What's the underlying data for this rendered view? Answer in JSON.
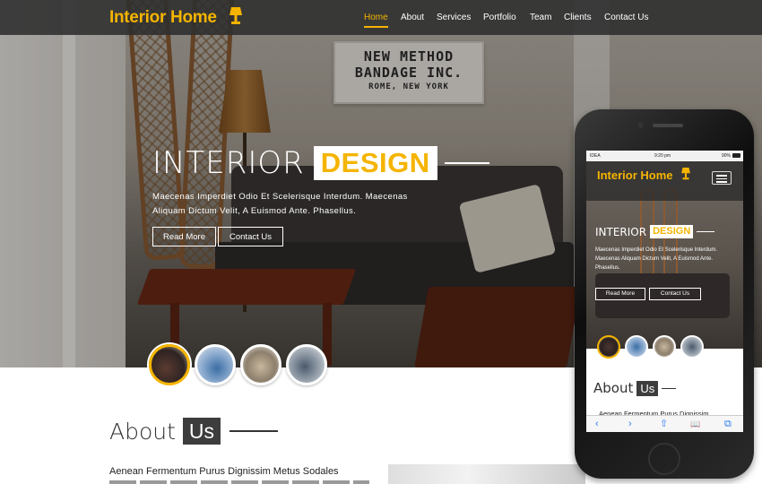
{
  "brand": {
    "name": "Interior Home",
    "accent": "#f5b400"
  },
  "nav": {
    "items": [
      {
        "label": "Home",
        "active": true
      },
      {
        "label": "About"
      },
      {
        "label": "Services"
      },
      {
        "label": "Portfolio"
      },
      {
        "label": "Team"
      },
      {
        "label": "Clients"
      },
      {
        "label": "Contact Us"
      }
    ]
  },
  "hero": {
    "sign": {
      "line1": "NEW METHOD",
      "line2": "BANDAGE INC.",
      "line3": "ROME, NEW YORK"
    },
    "title_plain": "INTERIOR",
    "title_highlight": "DESIGN",
    "description": "Maecenas Imperdiet Odio Et Scelerisque Interdum. Maecenas Aliquam Dictum Velit, A Euismod Ante. Phasellus.",
    "read_more_label": "Read More",
    "contact_label": "Contact Us",
    "thumbnails": [
      {
        "name": "living-room",
        "active": true
      },
      {
        "name": "blue-bedroom"
      },
      {
        "name": "dining-room"
      },
      {
        "name": "lounge"
      }
    ]
  },
  "about": {
    "title_plain": "About",
    "title_highlight": "Us",
    "text": "Aenean Fermentum Purus Dignissim Metus Sodales"
  },
  "phone": {
    "status": {
      "carrier": "IDEA",
      "time": "9:20 pm",
      "battery": "90%"
    },
    "logo": "Interior Home",
    "title_plain": "INTERIOR",
    "title_highlight": "DESIGN",
    "description": "Maecenas Imperdiet Odio Et Scelerisque Interdum. Maecenas Aliquam Dictum Velit, A Euismod Ante. Phasellus.",
    "read_more_label": "Read More",
    "contact_label": "Contact Us",
    "about_plain": "About",
    "about_highlight": "Us",
    "about_text": "Aenean Fermentum Purus Dignissim",
    "toolbar": {
      "back": "‹",
      "forward": "›",
      "share": "⇧",
      "bookmarks": "📖",
      "tabs": "⧉"
    }
  }
}
